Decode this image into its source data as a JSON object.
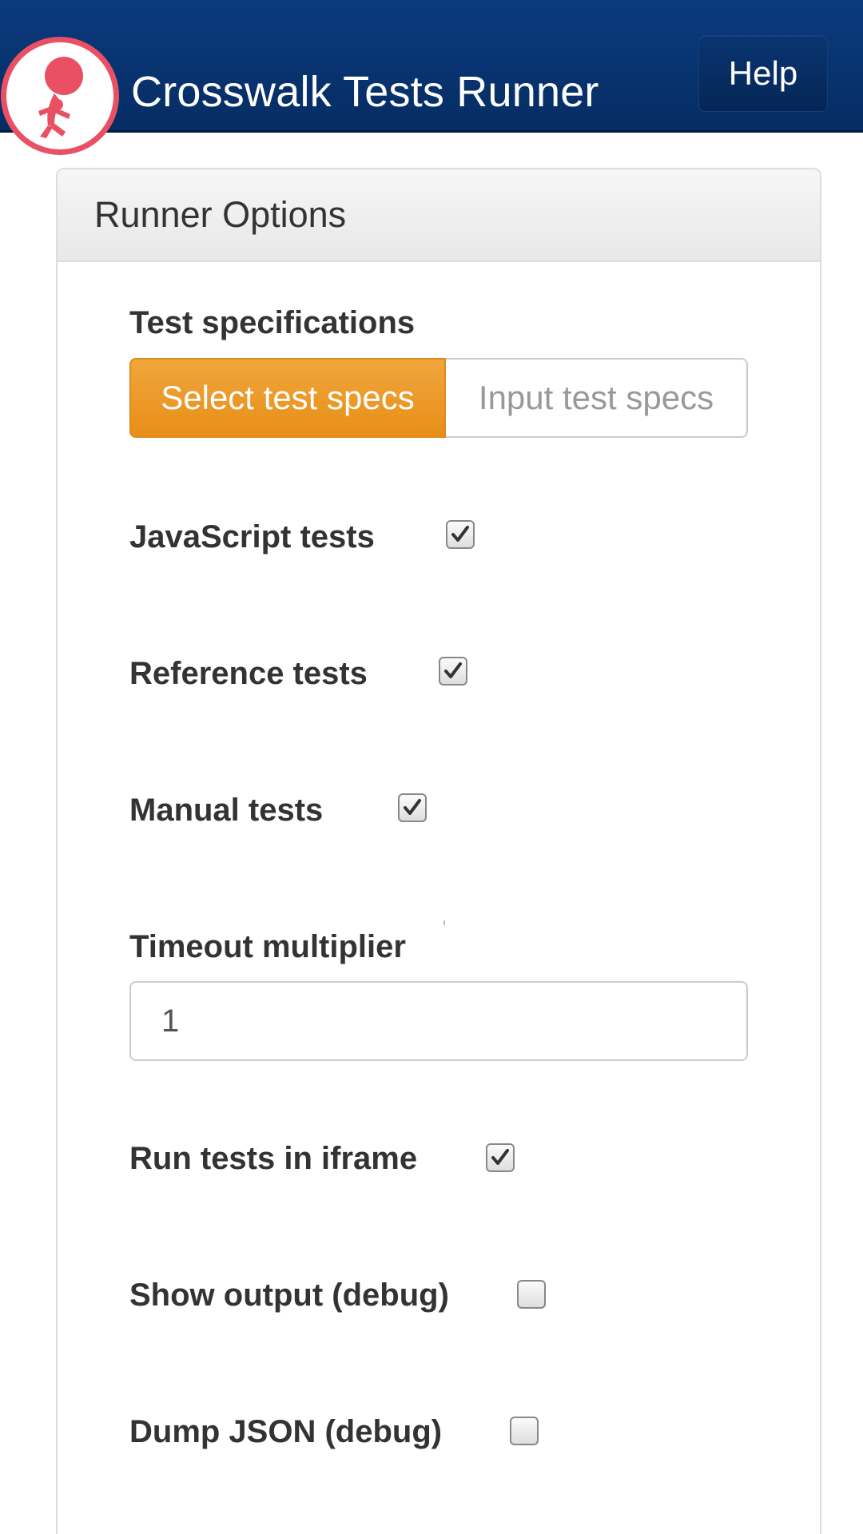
{
  "header": {
    "app_title": "Crosswalk Tests Runner",
    "help_label": "Help",
    "logo_icon": "crosswalk-runner-logo-icon",
    "colors": {
      "bar": "#0b3a7e",
      "logo_ring": "#e95064"
    }
  },
  "panel": {
    "title": "Runner Options"
  },
  "test_specs": {
    "label": "Test specifications",
    "options": [
      {
        "label": "Select test specs",
        "active": true
      },
      {
        "label": "Input test specs",
        "active": false
      }
    ],
    "active_color": "#ec9a28"
  },
  "options": [
    {
      "label": "JavaScript tests",
      "checked": true
    },
    {
      "label": "Reference tests",
      "checked": true
    },
    {
      "label": "Manual tests",
      "checked": true
    }
  ],
  "timeout": {
    "label": "Timeout multiplier",
    "value": "1"
  },
  "debug_options": [
    {
      "label": "Run tests in iframe",
      "checked": true
    },
    {
      "label": "Show output (debug)",
      "checked": false
    },
    {
      "label": "Dump JSON (debug)",
      "checked": false
    }
  ]
}
